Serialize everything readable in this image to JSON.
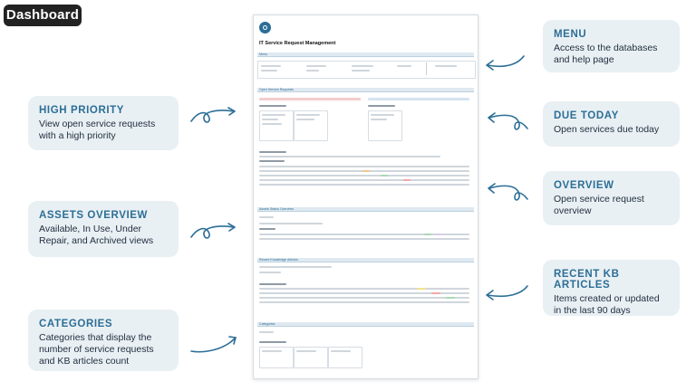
{
  "badge": "Dashboard",
  "callouts": {
    "high_priority": {
      "title": "HIGH PRIORITY",
      "body": "View open service requests with a high priority"
    },
    "assets": {
      "title": "ASSETS OVERVIEW",
      "body": "Available, In Use, Under Repair, and Archived views"
    },
    "categories": {
      "title": "CATEGORIES",
      "body": "Categories that display the number of service requests and KB articles count"
    },
    "menu": {
      "title": "MENU",
      "body": "Access to the databases and help page"
    },
    "due_today": {
      "title": "DUE TODAY",
      "body": "Open services due today"
    },
    "overview": {
      "title": "OVERVIEW",
      "body": "Open service request overview"
    },
    "recent_kb": {
      "title": "RECENT KB ARTICLES",
      "body": "Items created or updated in the last 90 days"
    }
  },
  "page": {
    "title": "IT Service Request Management",
    "sections": {
      "menu": "Menu",
      "open_requests": "Open Service Requests",
      "assets_overview": "Assets Status Overview",
      "recent_kb": "Recent Knowledge Articles",
      "categories": "Categories"
    }
  },
  "colors": {
    "accent": "#2c6e96",
    "callout_bg": "#e9f0f4",
    "badge_bg": "#222222"
  }
}
